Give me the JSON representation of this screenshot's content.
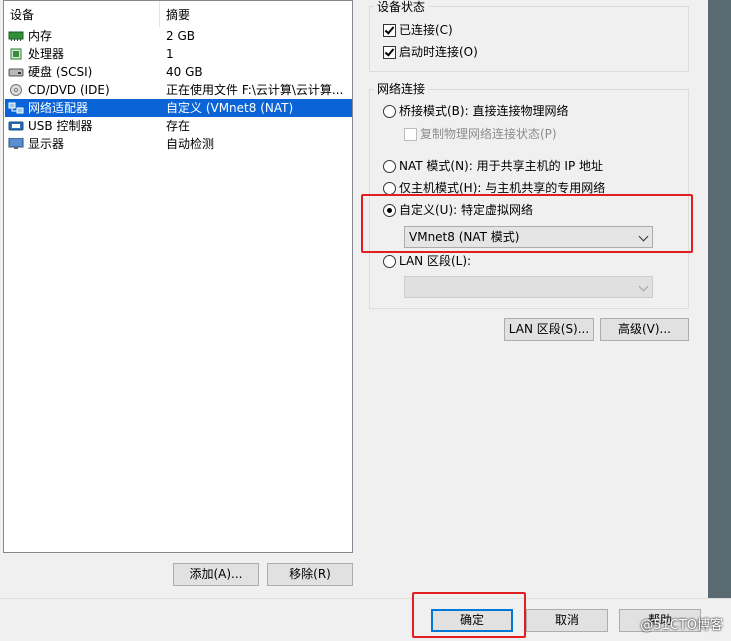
{
  "devices": {
    "header_device": "设备",
    "header_summary": "摘要",
    "rows": [
      {
        "name": "内存",
        "summary": "2 GB",
        "icon": "memory-icon",
        "selected": false
      },
      {
        "name": "处理器",
        "summary": "1",
        "icon": "cpu-icon",
        "selected": false
      },
      {
        "name": "硬盘 (SCSI)",
        "summary": "40 GB",
        "icon": "disk-icon",
        "selected": false
      },
      {
        "name": "CD/DVD (IDE)",
        "summary": "正在使用文件 F:\\云计算\\云计算...",
        "icon": "cd-icon",
        "selected": false
      },
      {
        "name": "网络适配器",
        "summary": "自定义 (VMnet8 (NAT)",
        "icon": "network-icon",
        "selected": true
      },
      {
        "name": "USB 控制器",
        "summary": "存在",
        "icon": "usb-icon",
        "selected": false
      },
      {
        "name": "显示器",
        "summary": "自动检测",
        "icon": "monitor-icon",
        "selected": false
      }
    ],
    "add_button": "添加(A)...",
    "remove_button": "移除(R)"
  },
  "device_status": {
    "title": "设备状态",
    "connected": "已连接(C)",
    "connect_at_power_on": "启动时连接(O)"
  },
  "network": {
    "title": "网络连接",
    "bridged": "桥接模式(B): 直接连接物理网络",
    "replicate": "复制物理网络连接状态(P)",
    "nat": "NAT 模式(N): 用于共享主机的 IP 地址",
    "host_only": "仅主机模式(H): 与主机共享的专用网络",
    "custom": "自定义(U): 特定虚拟网络",
    "custom_value": "VMnet8 (NAT 模式)",
    "lan_segment": "LAN 区段(L):",
    "lan_segments_button": "LAN 区段(S)...",
    "advanced_button": "高级(V)..."
  },
  "footer": {
    "ok": "确定",
    "cancel": "取消",
    "help": "帮助"
  },
  "watermark": "@51CTO博客",
  "colors": {
    "selection": "#0a64d8",
    "annotation_red": "#e02020",
    "default_button_border": "#0078d7"
  }
}
